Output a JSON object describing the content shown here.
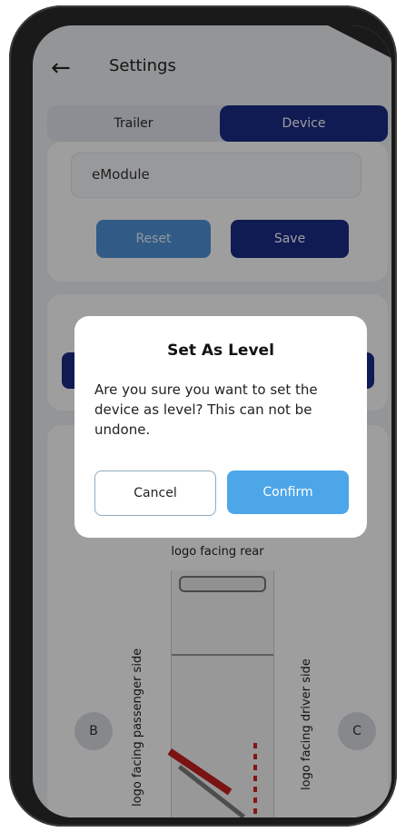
{
  "header": {
    "back_icon": "arrow-left-icon",
    "title": "Settings"
  },
  "tabs": [
    {
      "label": "Trailer",
      "active": false
    },
    {
      "label": "Device",
      "active": true
    }
  ],
  "device_card": {
    "module_field_value": "eModule",
    "reset_label": "Reset",
    "save_label": "Save"
  },
  "diagram": {
    "rear_label": "logo facing rear",
    "passenger_label": "logo facing passenger side",
    "driver_label": "logo facing driver side",
    "left_circle": "B",
    "right_circle": "C"
  },
  "dialog": {
    "title": "Set As Level",
    "message": "Are you sure you want to set the device as level? This can not be undone.",
    "cancel_label": "Cancel",
    "confirm_label": "Confirm"
  },
  "colors": {
    "primary": "#1a2a86",
    "accent": "#4da6e8",
    "reset_button": "#4f93d8"
  }
}
